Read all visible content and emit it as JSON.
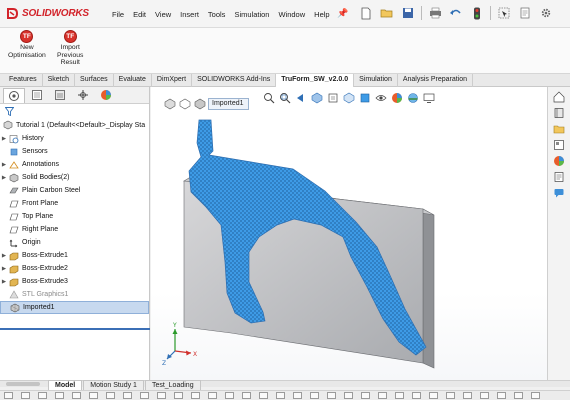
{
  "app": {
    "name": "SOLIDWORKS"
  },
  "menu": [
    "File",
    "Edit",
    "View",
    "Insert",
    "Tools",
    "Simulation",
    "Window",
    "Help"
  ],
  "quick_access_icons": [
    "new-icon",
    "open-icon",
    "save-icon",
    "print-icon",
    "undo-icon",
    "traffic-light-icon",
    "select-icon",
    "rebuild-icon",
    "options-icon"
  ],
  "command_manager": {
    "buttons": [
      {
        "badge": "TF",
        "lines": [
          "New",
          "Optimisation"
        ]
      },
      {
        "badge": "TF",
        "lines": [
          "Import",
          "Previous",
          "Result"
        ]
      }
    ]
  },
  "command_tabs": [
    "Features",
    "Sketch",
    "Surfaces",
    "Evaluate",
    "DimXpert",
    "SOLIDWORKS Add-Ins",
    "TruForm_SW_v2.0.0",
    "Simulation",
    "Analysis Preparation"
  ],
  "active_command_tab": "TruForm_SW_v2.0.0",
  "feature_tree": {
    "root": "Tutorial 1  (Default<<Default>_Display Sta",
    "items": [
      {
        "label": "History",
        "icon": "history-icon",
        "expand": true
      },
      {
        "label": "Sensors",
        "icon": "sensors-icon",
        "expand": false
      },
      {
        "label": "Annotations",
        "icon": "annotations-icon",
        "expand": true
      },
      {
        "label": "Solid Bodies(2)",
        "icon": "solid-bodies-icon",
        "expand": true
      },
      {
        "label": "Plain Carbon Steel",
        "icon": "material-icon",
        "expand": false
      },
      {
        "label": "Front Plane",
        "icon": "plane-icon",
        "expand": false
      },
      {
        "label": "Top Plane",
        "icon": "plane-icon",
        "expand": false
      },
      {
        "label": "Right Plane",
        "icon": "plane-icon",
        "expand": false
      },
      {
        "label": "Origin",
        "icon": "origin-icon",
        "expand": false
      },
      {
        "label": "Boss-Extrude1",
        "icon": "extrude-icon",
        "expand": true
      },
      {
        "label": "Boss-Extrude2",
        "icon": "extrude-icon",
        "expand": true
      },
      {
        "label": "Boss-Extrude3",
        "icon": "extrude-icon",
        "expand": true
      },
      {
        "label": "STL Graphics1",
        "icon": "stl-graphics-icon",
        "expand": false,
        "dim": true
      },
      {
        "label": "Imported1",
        "icon": "imported-body-icon",
        "expand": false,
        "selected": true
      }
    ]
  },
  "breadcrumb": {
    "label": "Imported1"
  },
  "bottom_tabs": [
    "Model",
    "Motion Study 1",
    "Test_Loading"
  ],
  "active_bottom_tab": "Model",
  "colors": {
    "accent": "#d2232a",
    "mesh": "#3e9be6",
    "selection": "#c7d9ef"
  }
}
